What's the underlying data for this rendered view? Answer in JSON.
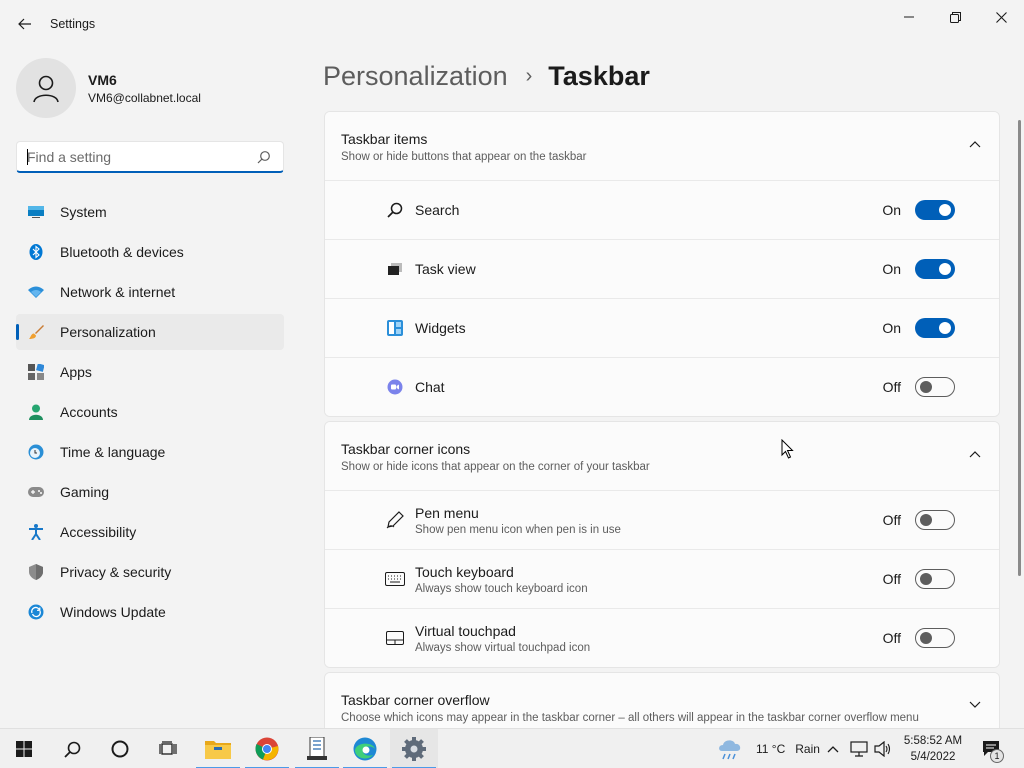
{
  "window": {
    "title": "Settings"
  },
  "profile": {
    "name": "VM6",
    "email": "VM6@collabnet.local"
  },
  "search": {
    "placeholder": "Find a setting"
  },
  "nav": {
    "items": [
      {
        "label": "System",
        "icon": "system-icon"
      },
      {
        "label": "Bluetooth & devices",
        "icon": "bluetooth-icon"
      },
      {
        "label": "Network & internet",
        "icon": "wifi-icon"
      },
      {
        "label": "Personalization",
        "icon": "brush-icon",
        "active": true
      },
      {
        "label": "Apps",
        "icon": "apps-icon"
      },
      {
        "label": "Accounts",
        "icon": "accounts-icon"
      },
      {
        "label": "Time & language",
        "icon": "clock-globe-icon"
      },
      {
        "label": "Gaming",
        "icon": "gamepad-icon"
      },
      {
        "label": "Accessibility",
        "icon": "accessibility-icon"
      },
      {
        "label": "Privacy & security",
        "icon": "shield-icon"
      },
      {
        "label": "Windows Update",
        "icon": "update-icon"
      }
    ]
  },
  "breadcrumb": {
    "parent": "Personalization",
    "separator": "›",
    "current": "Taskbar"
  },
  "sections": {
    "items": {
      "title": "Taskbar items",
      "subtitle": "Show or hide buttons that appear on the taskbar",
      "rows": [
        {
          "label": "Search",
          "state": "On",
          "on": true
        },
        {
          "label": "Task view",
          "state": "On",
          "on": true
        },
        {
          "label": "Widgets",
          "state": "On",
          "on": true
        },
        {
          "label": "Chat",
          "state": "Off",
          "on": false
        }
      ]
    },
    "corner": {
      "title": "Taskbar corner icons",
      "subtitle": "Show or hide icons that appear on the corner of your taskbar",
      "rows": [
        {
          "label": "Pen menu",
          "sub": "Show pen menu icon when pen is in use",
          "state": "Off",
          "on": false
        },
        {
          "label": "Touch keyboard",
          "sub": "Always show touch keyboard icon",
          "state": "Off",
          "on": false
        },
        {
          "label": "Virtual touchpad",
          "sub": "Always show virtual touchpad icon",
          "state": "Off",
          "on": false
        }
      ]
    },
    "overflow": {
      "title": "Taskbar corner overflow",
      "subtitle": "Choose which icons may appear in the taskbar corner – all others will appear in the taskbar corner overflow menu"
    }
  },
  "taskbar": {
    "weather": "11 °C",
    "weather_desc": "Rain",
    "time": "5:58:52 AM",
    "date": "5/4/2022",
    "notification_count": "1"
  },
  "colors": {
    "accent": "#005fb8",
    "background": "#f3f3f3",
    "card": "#fbfbfb"
  }
}
